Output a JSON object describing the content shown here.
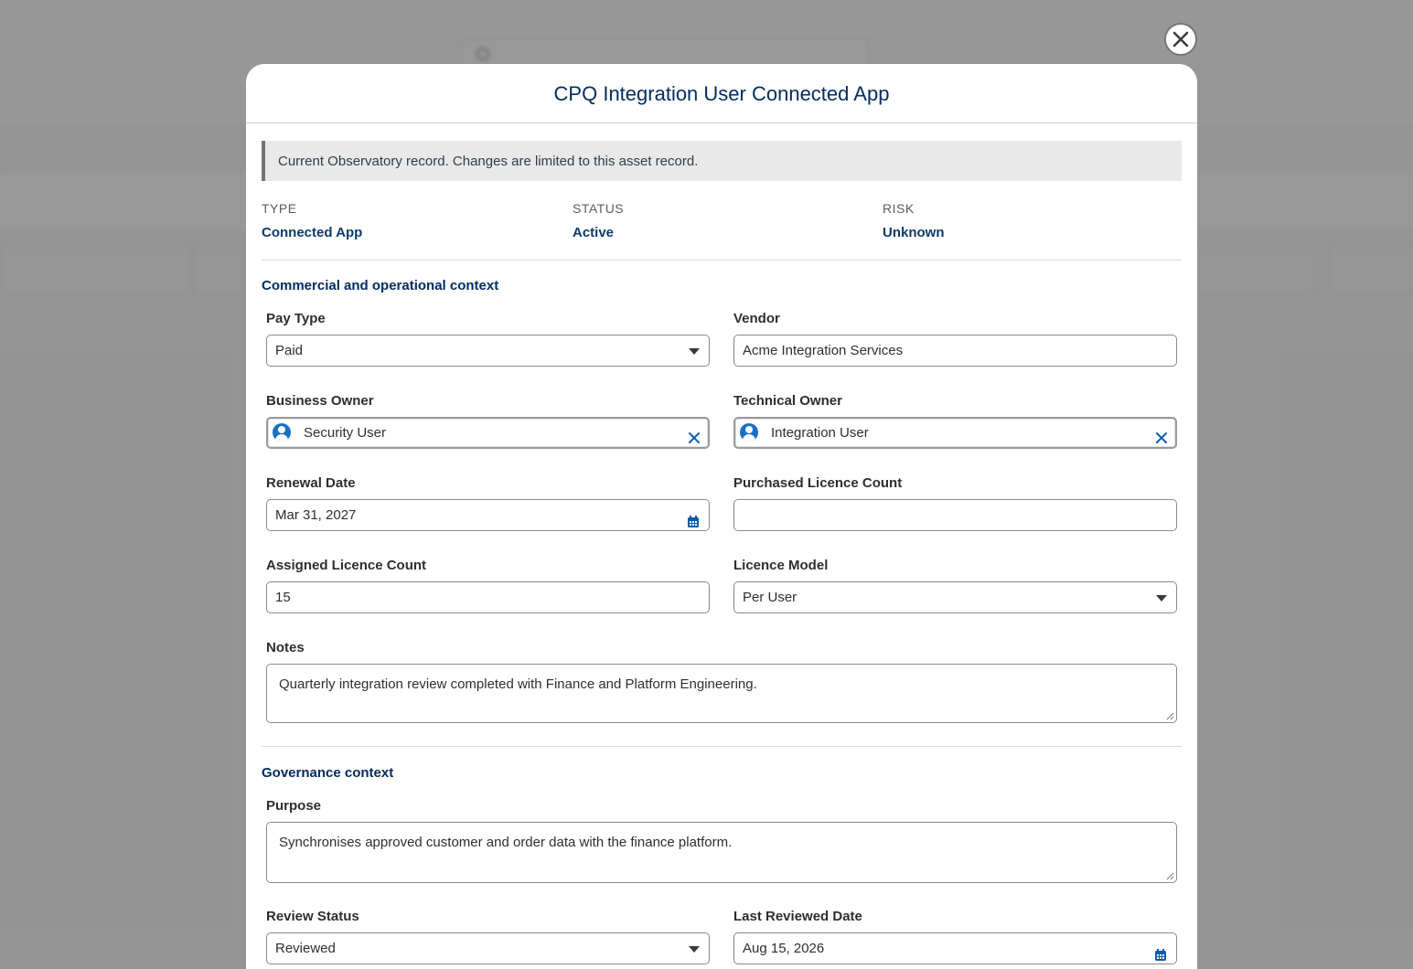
{
  "modal": {
    "title": "CPQ Integration User Connected App",
    "notice": "Current Observatory record. Changes are limited to this asset record."
  },
  "summary": {
    "type_label": "TYPE",
    "type_value": "Connected App",
    "status_label": "STATUS",
    "status_value": "Active",
    "risk_label": "RISK",
    "risk_value": "Unknown"
  },
  "commercial": {
    "title": "Commercial and operational context",
    "pay_type_label": "Pay Type",
    "pay_type_value": "Paid",
    "vendor_label": "Vendor",
    "vendor_value": "Acme Integration Services",
    "business_owner_label": "Business Owner",
    "business_owner_value": "Security User",
    "technical_owner_label": "Technical Owner",
    "technical_owner_value": "Integration User",
    "renewal_date_label": "Renewal Date",
    "renewal_date_value": "Mar 31, 2027",
    "purchased_count_label": "Purchased Licence Count",
    "purchased_count_value": "",
    "assigned_count_label": "Assigned Licence Count",
    "assigned_count_value": "15",
    "licence_model_label": "Licence Model",
    "licence_model_value": "Per User",
    "notes_label": "Notes",
    "notes_value": "Quarterly integration review completed with Finance and Platform Engineering."
  },
  "governance": {
    "title": "Governance context",
    "purpose_label": "Purpose",
    "purpose_value": "Synchronises approved customer and order data with the finance platform.",
    "review_status_label": "Review Status",
    "review_status_value": "Reviewed",
    "last_reviewed_label": "Last Reviewed Date",
    "last_reviewed_value": "Aug 15, 2026"
  },
  "colors": {
    "title": "#032d60",
    "accent": "#0b5cab",
    "overlay": "#707070"
  }
}
